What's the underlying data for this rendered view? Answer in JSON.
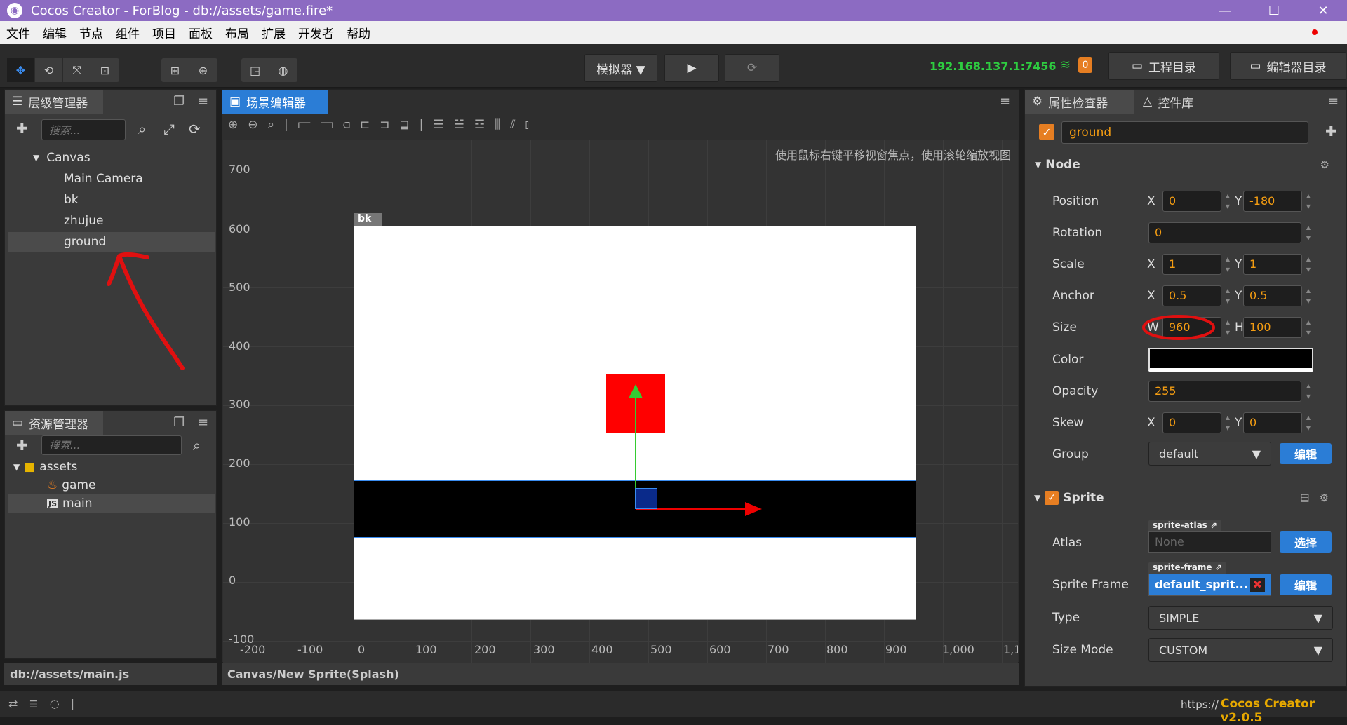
{
  "titlebar": {
    "title": "Cocos Creator - ForBlog - db://assets/game.fire*",
    "minimize": "—",
    "maximize": "☐",
    "close": "✕"
  },
  "menu": [
    "文件",
    "编辑",
    "节点",
    "组件",
    "项目",
    "面板",
    "布局",
    "扩展",
    "开发者",
    "帮助"
  ],
  "toolbar": {
    "simulator_label": "模拟器 ▼",
    "play_icon": "▶",
    "refresh_icon": "⟳",
    "ip": "192.168.137.1:7456",
    "badge_count": "0",
    "project_dir": "工程目录",
    "editor_dir": "编辑器目录"
  },
  "hierarchy": {
    "tab_label": "层级管理器",
    "search_placeholder": "搜索...",
    "nodes": [
      "Canvas",
      "Main Camera",
      "bk",
      "zhujue",
      "ground"
    ],
    "selected": "ground"
  },
  "assets": {
    "tab_label": "资源管理器",
    "search_placeholder": "搜索...",
    "items": [
      "assets",
      "game",
      "main"
    ],
    "path": "db://assets/main.js"
  },
  "scene": {
    "tab_label": "场景编辑器",
    "hint": "使用鼠标右键平移视窗焦点，使用滚轮缩放视图",
    "node_label": "bk",
    "y_labels": [
      "700",
      "600",
      "500",
      "400",
      "300",
      "200",
      "100",
      "0",
      "-100"
    ],
    "x_labels": [
      "-200",
      "-100",
      "0",
      "100",
      "200",
      "300",
      "400",
      "500",
      "600",
      "700",
      "800",
      "900",
      "1,000",
      "1,1"
    ],
    "path": "Canvas/New Sprite(Splash)"
  },
  "inspector": {
    "tab_label": "属性检查器",
    "tab2_label": "控件库",
    "node_name": "ground",
    "node_section": "Node",
    "position_label": "Position",
    "pos_x": "0",
    "pos_y": "-180",
    "rotation_label": "Rotation",
    "rotation": "0",
    "scale_label": "Scale",
    "scale_x": "1",
    "scale_y": "1",
    "anchor_label": "Anchor",
    "anchor_x": "0.5",
    "anchor_y": "0.5",
    "size_label": "Size",
    "size_w": "960",
    "size_h": "100",
    "color_label": "Color",
    "opacity_label": "Opacity",
    "opacity": "255",
    "skew_label": "Skew",
    "skew_x": "0",
    "skew_y": "0",
    "group_label": "Group",
    "group_value": "default",
    "edit_btn": "编辑",
    "sprite_section": "Sprite",
    "atlas_label": "Atlas",
    "atlas_tag": "sprite-atlas",
    "atlas_value": "None",
    "select_btn": "选择",
    "frame_label": "Sprite Frame",
    "frame_tag": "sprite-frame",
    "frame_value": "default_sprit...",
    "type_label": "Type",
    "type_value": "SIMPLE",
    "sizemode_label": "Size Mode",
    "sizemode_value": "CUSTOM",
    "x_lbl": "X",
    "y_lbl": "Y",
    "w_lbl": "W",
    "h_lbl": "H"
  },
  "statusbar": {
    "url": "https://",
    "version": "Cocos Creator v2.0.5"
  },
  "colors": {
    "accent": "#2b7dd6",
    "title": "#8c6bc2",
    "annotation": "#e01010"
  }
}
